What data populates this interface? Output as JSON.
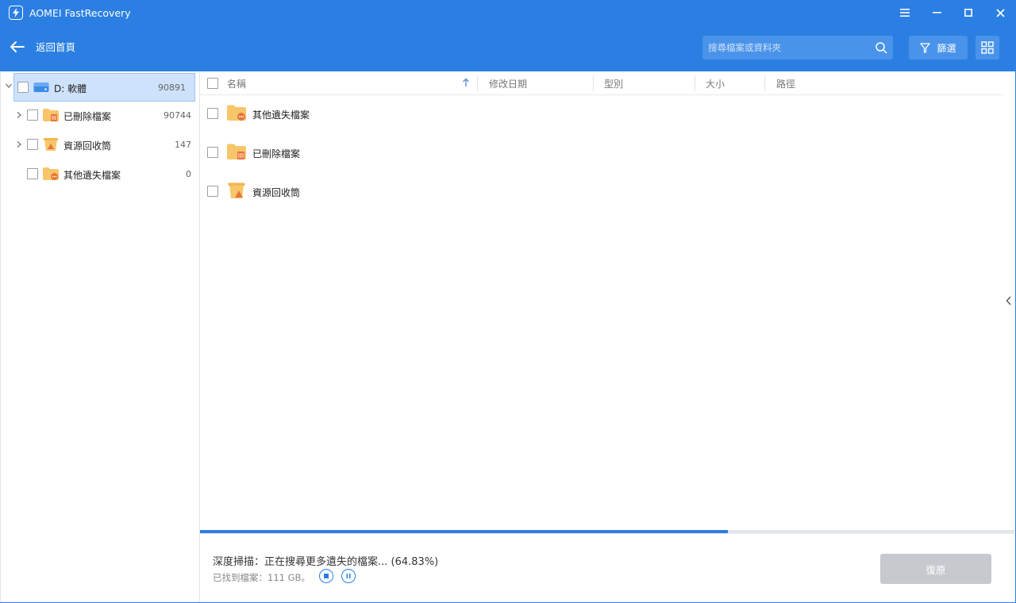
{
  "window": {
    "title": "AOMEI FastRecovery",
    "controls": {
      "menu_icon": "hamburger-icon",
      "minimize_icon": "minimize-icon",
      "maximize_icon": "maximize-icon",
      "close_icon": "close-icon"
    }
  },
  "navbar": {
    "back_label": "返回首頁",
    "search_placeholder": "搜尋檔案或資料夾",
    "filter_label": "篩選"
  },
  "sidebar": {
    "root": {
      "label": "D: 軟體",
      "count": "90891",
      "expanded": true
    },
    "items": [
      {
        "label": "已刪除檔案",
        "count": "90744",
        "expandable": true,
        "icon": "deleted-folder-icon"
      },
      {
        "label": "資源回收筒",
        "count": "147",
        "expandable": true,
        "icon": "recycle-bin-icon"
      },
      {
        "label": "其他遺失檔案",
        "count": "0",
        "expandable": false,
        "icon": "lost-folder-icon"
      }
    ]
  },
  "table": {
    "columns": [
      "名稱",
      "修改日期",
      "型別",
      "大小",
      "路徑"
    ],
    "sort_column": "名稱",
    "rows": [
      {
        "name": "其他遺失檔案",
        "icon": "lost-folder-icon"
      },
      {
        "name": "已刪除檔案",
        "icon": "deleted-folder-icon"
      },
      {
        "name": "資源回收筒",
        "icon": "recycle-bin-icon"
      }
    ]
  },
  "status": {
    "scan_text": "深度掃描：正在搜尋更多遺失的檔案... (64.83%)",
    "progress": 0.6483,
    "found_text": "已找到檔案：111 GB。",
    "recover_label": "復原"
  },
  "colors": {
    "accent": "#2b7fe3",
    "folder": "#f7c66a",
    "badge": "#e8753a"
  }
}
